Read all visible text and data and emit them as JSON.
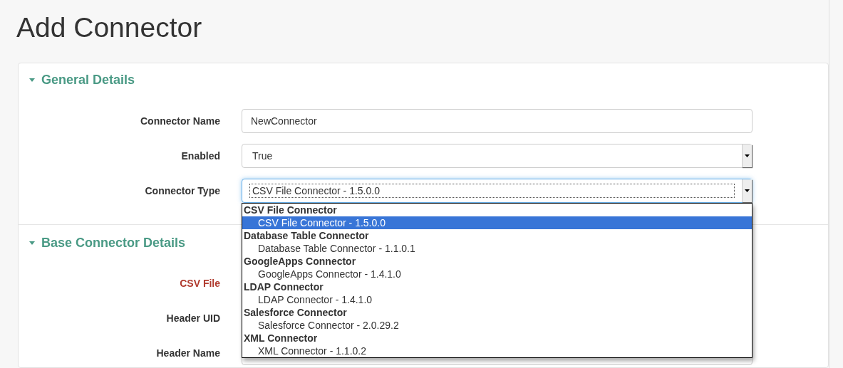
{
  "page": {
    "title": "Add Connector"
  },
  "sections": [
    {
      "title": "General Details",
      "expanded": true,
      "fields": [
        {
          "label": "Connector Name",
          "kind": "text",
          "value": "NewConnector",
          "required": false,
          "focused": false
        },
        {
          "label": "Enabled",
          "kind": "select",
          "value": "True",
          "required": false,
          "focused": false
        },
        {
          "label": "Connector Type",
          "kind": "select",
          "value": "CSV File Connector - 1.5.0.0",
          "required": false,
          "focused": true
        }
      ]
    },
    {
      "title": "Base Connector Details",
      "expanded": true,
      "fields": [
        {
          "label": "CSV File",
          "kind": "covered",
          "required": true
        },
        {
          "label": "Header UID",
          "kind": "covered",
          "required": false
        },
        {
          "label": "Header Name",
          "kind": "text",
          "required": false,
          "focused": false
        }
      ]
    }
  ],
  "dropdown": {
    "groups": [
      {
        "label": "CSV File Connector",
        "options": [
          {
            "label": "CSV File Connector - 1.5.0.0",
            "selected": true
          }
        ]
      },
      {
        "label": "Database Table Connector",
        "options": [
          {
            "label": "Database Table Connector - 1.1.0.1",
            "selected": false
          }
        ]
      },
      {
        "label": "GoogleApps Connector",
        "options": [
          {
            "label": "GoogleApps Connector - 1.4.1.0",
            "selected": false
          }
        ]
      },
      {
        "label": "LDAP Connector",
        "options": [
          {
            "label": "LDAP Connector - 1.4.1.0",
            "selected": false
          }
        ]
      },
      {
        "label": "Salesforce Connector",
        "options": [
          {
            "label": "Salesforce Connector - 2.0.29.2",
            "selected": false
          }
        ]
      },
      {
        "label": "XML Connector",
        "options": [
          {
            "label": "XML Connector - 1.1.0.2",
            "selected": false
          }
        ]
      }
    ]
  }
}
